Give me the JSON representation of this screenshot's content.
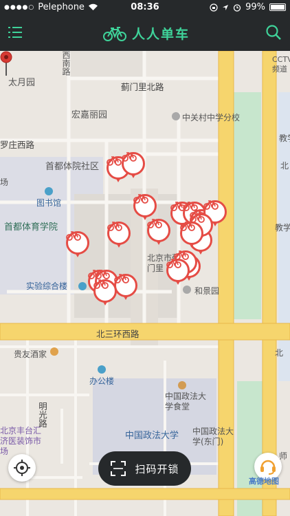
{
  "status_bar": {
    "signal": "●●●●○",
    "carrier": "Pelephone",
    "time": "08:36",
    "battery": "99%"
  },
  "header": {
    "title": "人人单车",
    "menu_icon": "menu-icon",
    "search_icon": "search-icon",
    "logo_icon": "bike-logo-icon"
  },
  "accent_color": "#3fd39a",
  "marker_color": "#e54c45",
  "map": {
    "labels": [
      "西南路",
      "太月园",
      "蓟门里北路",
      "宏嘉丽园",
      "中关村中学分校",
      "罗庄西路",
      "首都体院社区",
      "图书馆",
      "首都体育学院",
      "小区",
      "北京市蓟门里",
      "实验综合楼",
      "和景园",
      "北三环西路",
      "贵友酒家",
      "办公楼",
      "明光路",
      "中国政法大学食堂",
      "中国政法大学",
      "中国政法大学(东门)",
      "北京丰台汇济医装饰市场",
      "CCTV频道",
      "教学",
      "北",
      "教学楼",
      "场",
      "师",
      "北"
    ],
    "bike_markers": 20
  },
  "bottom": {
    "scan_label": "扫码开锁",
    "scan_icon": "scan-icon",
    "locate_icon": "locate-icon",
    "service_icon": "customer-service-icon",
    "map_brand": "高德地图"
  }
}
